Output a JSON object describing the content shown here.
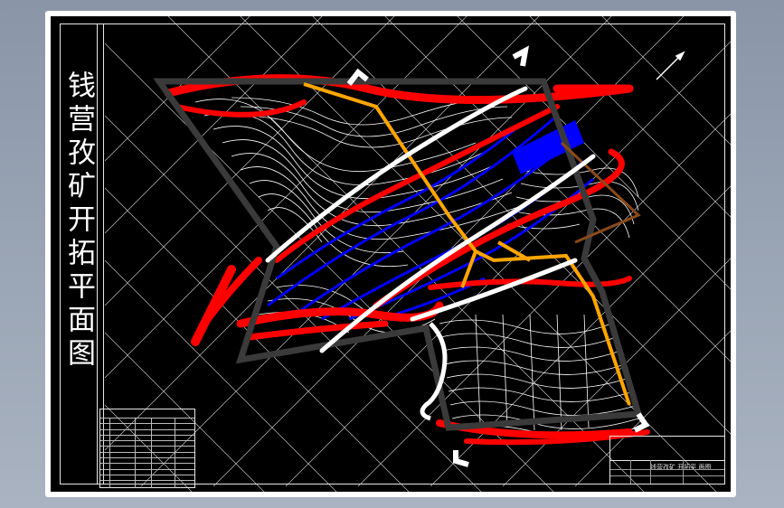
{
  "drawing": {
    "vertical_title": "钱营孜矿开拓平面图",
    "title_block_name": "钱营孜矿 开拓平 面图"
  },
  "colors": {
    "background": "#000000",
    "boundary": "#3a3a3a",
    "contour": "#ffffff",
    "workings": "#ff0000",
    "seam": "#0000ff",
    "roadway": "#ffa500",
    "grid": "#d8d8d8"
  }
}
